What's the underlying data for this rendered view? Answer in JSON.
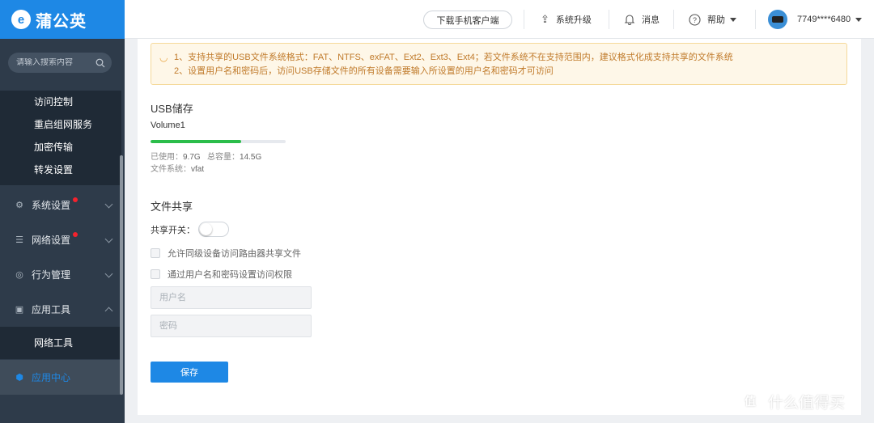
{
  "app": {
    "logo_mark": "e",
    "name": "蒲公英"
  },
  "sidebar": {
    "search_placeholder": "请输入搜索内容",
    "sub_items_top": [
      "访问控制",
      "重启组网服务",
      "加密传输",
      "转发设置"
    ],
    "menus": [
      {
        "label": "系统设置",
        "icon": "gear-icon",
        "badge": true
      },
      {
        "label": "网络设置",
        "icon": "list-icon",
        "badge": true
      },
      {
        "label": "行为管理",
        "icon": "eye-icon",
        "badge": false
      },
      {
        "label": "应用工具",
        "icon": "briefcase-icon",
        "badge": false
      }
    ],
    "sub_items_tools": [
      "网络工具"
    ],
    "active_menu": {
      "label": "应用中心",
      "icon": "cube-icon"
    }
  },
  "topbar": {
    "download_label": "下载手机客户端",
    "upgrade_label": "系统升级",
    "messages_label": "消息",
    "help_label": "帮助",
    "user_id": "7749****6480"
  },
  "notice": {
    "line1": "1、支持共享的USB文件系统格式：FAT、NTFS、exFAT、Ext2、Ext3、Ext4；若文件系统不在支持范围内，建议格式化成支持共享的文件系统",
    "line2": "2、设置用户名和密码后，访问USB存储文件的所有设备需要输入所设置的用户名和密码才可访问"
  },
  "usb": {
    "title": "USB储存",
    "volume_name": "Volume1",
    "used_label": "已使用：",
    "used_value": "9.7G",
    "total_label": "总容量：",
    "total_value": "14.5G",
    "fs_label": "文件系统：",
    "fs_value": "vfat",
    "used_fraction": 0.669,
    "bar_color": "#2bbd4a"
  },
  "share": {
    "title": "文件共享",
    "toggle_label": "共享开关：",
    "toggle_on": false,
    "option_lan": "允许同级设备访问路由器共享文件",
    "option_auth": "通过用户名和密码设置访问权限",
    "username_placeholder": "用户名",
    "password_placeholder": "密码",
    "save_label": "保存"
  },
  "watermark": {
    "mark": "值",
    "text": "什么值得买"
  },
  "colors": {
    "accent": "#1e88e5",
    "sidebar": "#2e3b4a",
    "notice_bg": "#fef7e8",
    "notice_text": "#c07a2a"
  }
}
